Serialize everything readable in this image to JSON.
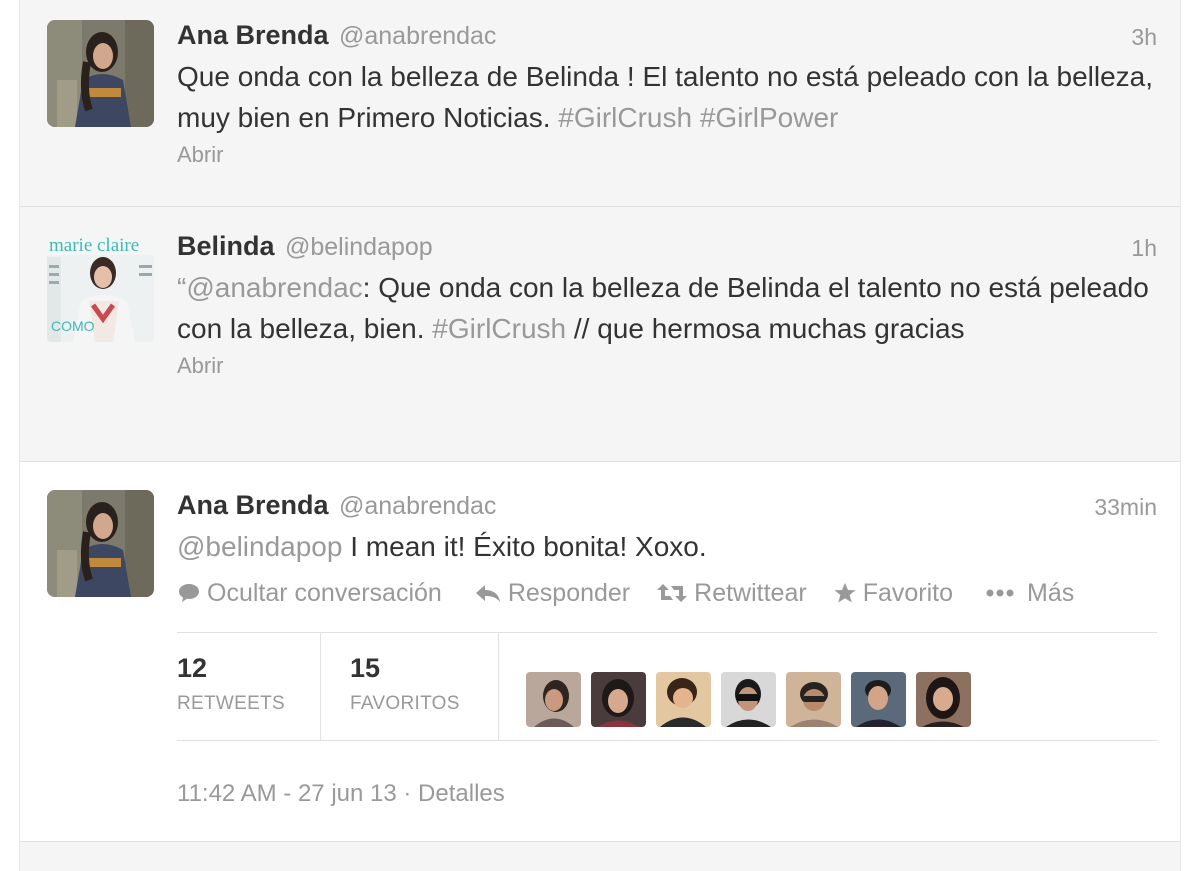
{
  "tweets": [
    {
      "name": "Ana Brenda",
      "handle": "@anabrendac",
      "time": "3h",
      "text_plain": "Que onda con la belleza de Belinda ! El talento no está peleado con la belleza, muy bien en Primero Noticias.",
      "hashtag1": "#GirlCrush",
      "hashtag2": "#GirlPower",
      "expand_label": "Abrir"
    },
    {
      "name": "Belinda",
      "handle": "@belindapop",
      "time": "1h",
      "quote_open": "“",
      "mention": "@anabrendac",
      "text_a": ": Que onda con la belleza de Belinda el talento no está peleado con la belleza, bien.",
      "hashtag": "#GirlCrush",
      "text_b": "// que hermosa muchas gracias",
      "expand_label": "Abrir"
    },
    {
      "name": "Ana Brenda",
      "handle": "@anabrendac",
      "time": "33min",
      "mention": "@belindapop",
      "text": "I mean it! Éxito bonita! Xoxo.",
      "actions": {
        "hide": "Ocultar conversación",
        "reply": "Responder",
        "retweet": "Retwittear",
        "favorite": "Favorito",
        "more": "Más"
      },
      "stats": {
        "retweets_count": "12",
        "retweets_label": "RETWEETS",
        "favorites_count": "15",
        "favorites_label": "FAVORITOS"
      },
      "timestamp": "11:42 AM - 27 jun 13",
      "details_label": "Detalles"
    }
  ],
  "icons": {
    "hide": "speech-bubble-icon",
    "reply": "reply-arrow-icon",
    "retweet": "retweet-icon",
    "favorite": "star-icon",
    "more": "more-dots-icon"
  },
  "colors": {
    "muted_text": "#999999",
    "body_text": "#333333",
    "tweet_background": "#f5f5f5",
    "divider": "#e1e1e1"
  }
}
